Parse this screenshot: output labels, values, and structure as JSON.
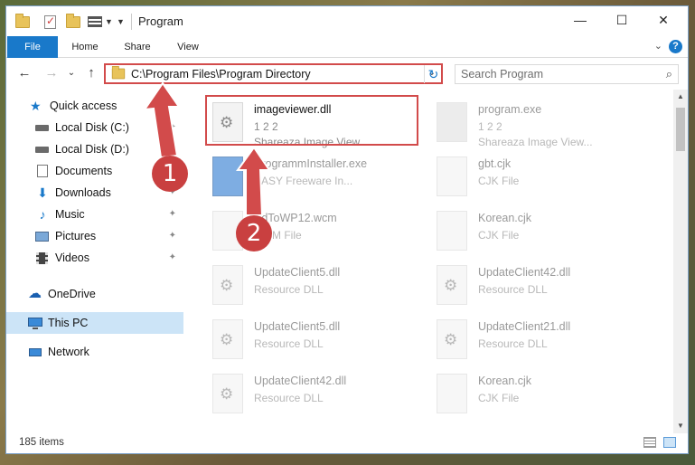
{
  "window": {
    "title": "Program",
    "minimize": "—",
    "maximize": "☐",
    "close": "✕"
  },
  "ribbon": {
    "tabs": [
      "File",
      "Home",
      "Share",
      "View"
    ],
    "help": "?",
    "collapse": "⌄"
  },
  "nav": {
    "back": "←",
    "forward": "→",
    "recent": "⌄",
    "up": "↑",
    "address_path": "C:\\Program Files\\Program Directory",
    "address_caret": "⌄",
    "refresh": "↻",
    "search_placeholder": "Search Program",
    "search_icon": "⌕"
  },
  "sidebar": {
    "items": [
      {
        "label": "Quick access",
        "icon": "star-icon",
        "color": "#1979ca"
      },
      {
        "label": "Local Disk (C:)",
        "icon": "drive-icon",
        "pinned": true
      },
      {
        "label": "Local Disk (D:)",
        "icon": "drive-icon",
        "pinned": true
      },
      {
        "label": "Documents",
        "icon": "documents-icon",
        "pinned": true
      },
      {
        "label": "Downloads",
        "icon": "download-icon",
        "pinned": true
      },
      {
        "label": "Music",
        "icon": "music-icon",
        "pinned": true
      },
      {
        "label": "Pictures",
        "icon": "pictures-icon",
        "pinned": true
      },
      {
        "label": "Videos",
        "icon": "videos-icon",
        "pinned": true
      },
      {
        "label": "OneDrive",
        "icon": "cloud-icon"
      },
      {
        "label": "This PC",
        "icon": "computer-icon",
        "selected": true
      },
      {
        "label": "Network",
        "icon": "network-icon"
      }
    ],
    "pin_glyph": "📌"
  },
  "files": {
    "left": [
      {
        "name": "imageviewer.dll",
        "line2": "1 2 2",
        "line3": "Shareaza Image View...",
        "faded": false
      },
      {
        "name": "ProgrammInstaller.exe",
        "line2": "EASY Freeware In...",
        "line3": "",
        "faded": true
      },
      {
        "name": "EdToWP12.wcm",
        "line2": "WCM File",
        "line3": "",
        "faded": true
      },
      {
        "name": "UpdateClient5.dll",
        "line2": "Resource DLL",
        "line3": "",
        "faded": true
      },
      {
        "name": "UpdateClient5.dll",
        "line2": "Resource DLL",
        "line3": "",
        "faded": true
      },
      {
        "name": "UpdateClient42.dll",
        "line2": "Resource DLL",
        "line3": "",
        "faded": true
      }
    ],
    "right": [
      {
        "name": "program.exe",
        "line2": "1 2 2",
        "line3": "Shareaza Image View...",
        "faded": true
      },
      {
        "name": "gbt.cjk",
        "line2": "CJK File",
        "line3": "",
        "faded": true
      },
      {
        "name": "Korean.cjk",
        "line2": "CJK File",
        "line3": "",
        "faded": true
      },
      {
        "name": "UpdateClient42.dll",
        "line2": "Resource DLL",
        "line3": "",
        "faded": true
      },
      {
        "name": "UpdateClient21.dll",
        "line2": "Resource DLL",
        "line3": "",
        "faded": true
      },
      {
        "name": "Korean.cjk",
        "line2": "CJK File",
        "line3": "",
        "faded": true
      }
    ]
  },
  "status": {
    "items_count": "185 items"
  },
  "annotations": {
    "callout_1": "1",
    "callout_2": "2",
    "accent": "#d24b4b"
  }
}
